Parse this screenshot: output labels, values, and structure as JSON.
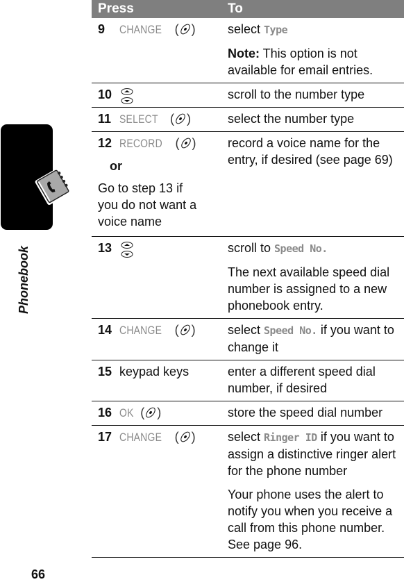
{
  "sidebar": {
    "section_label": "Phonebook",
    "icon": "phonebook-icon"
  },
  "page_number": "66",
  "table": {
    "headers": {
      "press": "Press",
      "to": "To"
    },
    "rows": [
      {
        "step": "9",
        "press": {
          "softkey": "CHANGE",
          "key_icon": "menu-key-icon"
        },
        "to": [
          {
            "prefix": "select ",
            "display": "Type",
            "suffix": ""
          },
          {
            "note_label": "Note:",
            "text": " This option is not available for email entries."
          }
        ]
      },
      {
        "step": "10",
        "press": {
          "key_icon": "scroll-key-icon"
        },
        "to": [
          {
            "text": "scroll to the number type"
          }
        ]
      },
      {
        "step": "11",
        "press": {
          "softkey": "SELECT",
          "key_icon": "menu-key-icon"
        },
        "to": [
          {
            "text": "select the number type"
          }
        ]
      },
      {
        "step": "12",
        "press": {
          "softkey": "RECORD",
          "key_icon": "menu-key-icon",
          "or": "or",
          "alt_text": "Go to step 13 if you do not want a voice name"
        },
        "to": [
          {
            "text": "record a voice name for the entry, if desired (see page 69)"
          }
        ]
      },
      {
        "step": "13",
        "press": {
          "key_icon": "scroll-key-icon"
        },
        "to": [
          {
            "prefix": "scroll to ",
            "display": "Speed No.",
            "suffix": ""
          },
          {
            "text": "The next available speed dial number is assigned to a new phonebook entry."
          }
        ]
      },
      {
        "step": "14",
        "press": {
          "softkey": "CHANGE",
          "key_icon": "menu-key-icon"
        },
        "to": [
          {
            "prefix": "select ",
            "display": "Speed No.",
            "suffix": " if you want to change it"
          }
        ]
      },
      {
        "step": "15",
        "press": {
          "text": "keypad keys"
        },
        "to": [
          {
            "text": "enter a different speed dial number, if desired"
          }
        ]
      },
      {
        "step": "16",
        "press": {
          "softkey": "OK",
          "key_icon": "menu-key-icon"
        },
        "to": [
          {
            "text": "store the speed dial number"
          }
        ]
      },
      {
        "step": "17",
        "press": {
          "softkey": "CHANGE",
          "key_icon": "menu-key-icon"
        },
        "to": [
          {
            "prefix": "select ",
            "display": "Ringer ID",
            "suffix": " if you want to assign a distinctive ringer alert for the phone number"
          },
          {
            "text": "Your phone uses the alert to notify you when you receive a call from this phone number. See page 96."
          }
        ]
      }
    ]
  },
  "colors": {
    "header_bg": "#7f7f7f",
    "softkey_text": "#8a8a8a",
    "sidetab_bg": "#000000"
  }
}
